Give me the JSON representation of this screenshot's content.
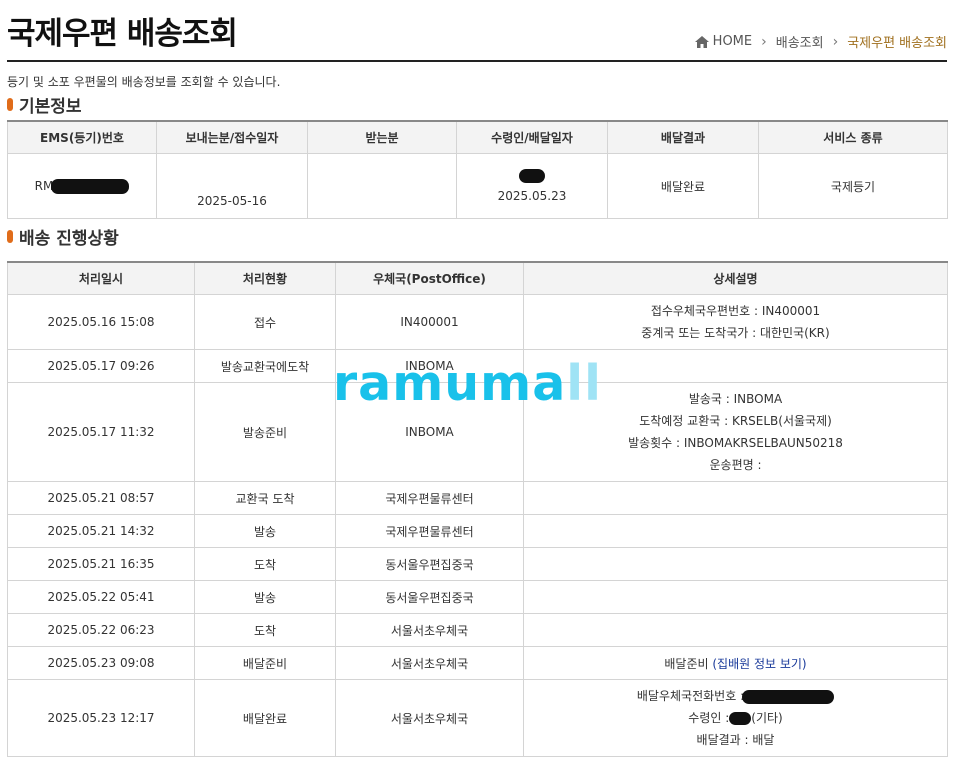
{
  "header": {
    "title": "국제우편 배송조회",
    "breadcrumb": {
      "home": "HOME",
      "level1": "배송조회",
      "current": "국제우편 배송조회"
    }
  },
  "intro": "등기 및 소포 우편물의 배송정보를 조회할 수 있습니다.",
  "basic_info": {
    "section_title": "기본정보",
    "columns": [
      "EMS(등기)번호",
      "보내는분/접수일자",
      "받는분",
      "수령인/배달일자",
      "배달결과",
      "서비스 종류"
    ],
    "row": {
      "ems_prefix": "RM",
      "send_date": "2025-05-16",
      "receiver": "",
      "delivery_date": "2025.05.23",
      "result": "배달완료",
      "service": "국제등기"
    }
  },
  "progress": {
    "section_title": "배송 진행상황",
    "columns": [
      "처리일시",
      "처리현황",
      "우체국(PostOffice)",
      "상세설명"
    ],
    "rows": [
      {
        "datetime": "2025.05.16 15:08",
        "status": "접수",
        "office": "IN400001",
        "detail": [
          "접수우체국우편번호 : IN400001",
          "중계국 또는 도착국가 : 대한민국(KR)"
        ]
      },
      {
        "datetime": "2025.05.17 09:26",
        "status": "발송교환국에도착",
        "office": "INBOMA",
        "detail": []
      },
      {
        "datetime": "2025.05.17 11:32",
        "status": "발송준비",
        "office": "INBOMA",
        "detail": [
          "발송국 : INBOMA",
          "도착예정 교환국 : KRSELB(서울국제)",
          "발송횟수 : INBOMAKRSELBAUN50218",
          "운송편명 :"
        ]
      },
      {
        "datetime": "2025.05.21 08:57",
        "status": "교환국 도착",
        "office": "국제우편물류센터",
        "detail": []
      },
      {
        "datetime": "2025.05.21 14:32",
        "status": "발송",
        "office": "국제우편물류센터",
        "detail": []
      },
      {
        "datetime": "2025.05.21 16:35",
        "status": "도착",
        "office": "동서울우편집중국",
        "detail": []
      },
      {
        "datetime": "2025.05.22 05:41",
        "status": "발송",
        "office": "동서울우편집중국",
        "detail": []
      },
      {
        "datetime": "2025.05.22 06:23",
        "status": "도착",
        "office": "서울서초우체국",
        "detail": []
      },
      {
        "datetime": "2025.05.23 09:08",
        "status": "배달준비",
        "office": "서울서초우체국",
        "detail_prefix": "배달준비 ",
        "detail_link": "(집배원 정보 보기)"
      },
      {
        "datetime": "2025.05.23 12:17",
        "status": "배달완료",
        "office": "서울서초우체국",
        "detail_phone_label": "배달우체국전화번호 :",
        "detail_recipient_label": "수령인 :",
        "detail_recipient_suffix": "(기타)",
        "detail_result": "배달결과 : 배달"
      }
    ]
  },
  "watermark": {
    "main": "ramuma",
    "faded": "ll"
  },
  "colors": {
    "accent": "#e06c1a",
    "breadcrumb_current": "#a0701f",
    "link": "#1a3a9a",
    "watermark": "#19c1ea"
  }
}
